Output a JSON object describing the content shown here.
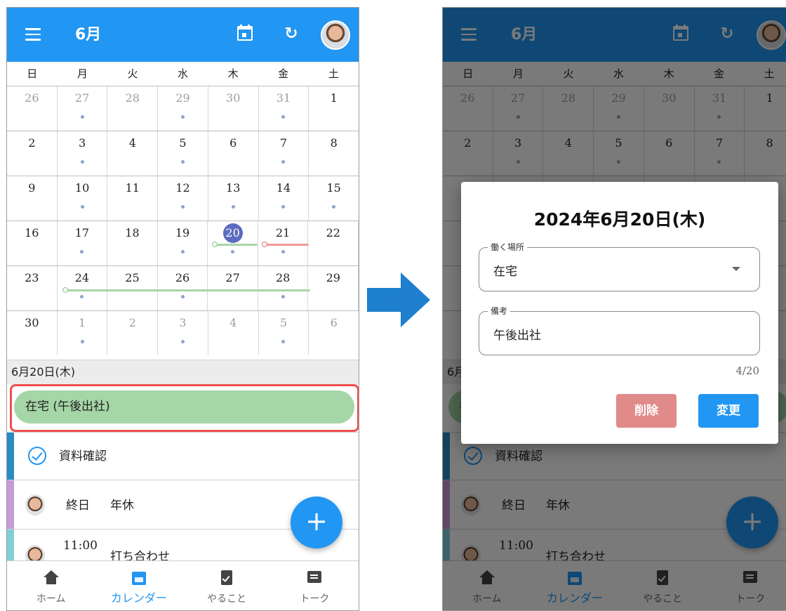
{
  "header": {
    "month": "6月"
  },
  "weekdays": [
    "日",
    "月",
    "火",
    "水",
    "木",
    "金",
    "土"
  ],
  "weeks": [
    [
      "26",
      "27",
      "28",
      "29",
      "30",
      "31",
      "1"
    ],
    [
      "2",
      "3",
      "4",
      "5",
      "6",
      "7",
      "8"
    ],
    [
      "9",
      "10",
      "11",
      "12",
      "13",
      "14",
      "15"
    ],
    [
      "16",
      "17",
      "18",
      "19",
      "20",
      "21",
      "22"
    ],
    [
      "23",
      "24",
      "25",
      "26",
      "27",
      "28",
      "29"
    ],
    [
      "30",
      "1",
      "2",
      "3",
      "4",
      "5",
      "6"
    ]
  ],
  "selected_date": "6月20日(木)",
  "events": {
    "work_place": "在宅 (午後出社)",
    "todo": "資料確認",
    "allday_label": "終日",
    "allday_title": "年休",
    "meeting_time": "11:00",
    "meeting_title": "打ち合わせ"
  },
  "fab": "+",
  "tabs": [
    {
      "label": "ホーム"
    },
    {
      "label": "カレンダー"
    },
    {
      "label": "やること"
    },
    {
      "label": "トーク"
    }
  ],
  "dialog": {
    "title": "2024年6月20日(木)",
    "place_label": "働く場所",
    "place_value": "在宅",
    "note_label": "備考",
    "note_value": "午後出社",
    "counter": "4/20",
    "delete_label": "削除",
    "change_label": "変更"
  },
  "colors": {
    "primary": "#2196f3",
    "today": "#5c6bc0",
    "highlight": "#f04e4e",
    "work_pill": "#a5d6a7",
    "delete": "#e08a8a"
  }
}
